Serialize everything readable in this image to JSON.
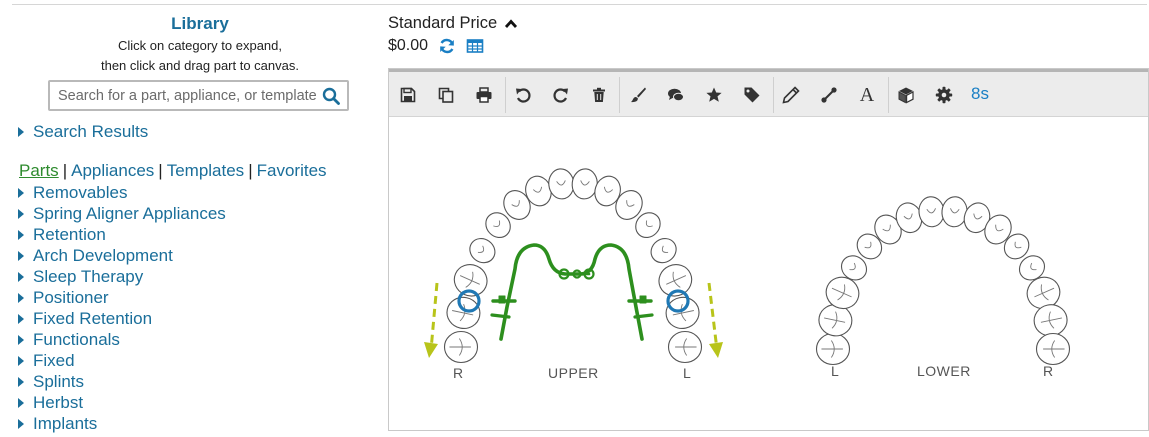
{
  "library": {
    "title": "Library",
    "help_line1": "Click on category to expand,",
    "help_line2": "then click and drag part to canvas.",
    "search_placeholder": "Search for a part, appliance, or template",
    "search_results_label": "Search Results",
    "tabs": [
      {
        "label": "Parts",
        "active": true
      },
      {
        "label": "Appliances",
        "active": false
      },
      {
        "label": "Templates",
        "active": false
      },
      {
        "label": "Favorites",
        "active": false
      }
    ],
    "tab_separator": "|",
    "categories": [
      "Removables",
      "Spring Aligner Appliances",
      "Retention",
      "Arch Development",
      "Sleep Therapy",
      "Positioner",
      "Fixed Retention",
      "Functionals",
      "Fixed",
      "Splints",
      "Herbst",
      "Implants"
    ]
  },
  "price": {
    "title": "Standard Price",
    "value": "$0.00"
  },
  "toolbar": {
    "icons": [
      "save-icon",
      "copy-icon",
      "print-icon",
      "undo-icon",
      "redo-icon",
      "trash-icon",
      "brush-icon",
      "comment-icon",
      "star-icon",
      "tag-icon",
      "pencil-icon",
      "connector-icon",
      "text-icon",
      "cube-icon",
      "gear-icon"
    ],
    "text_tool_label": "A",
    "timer_label": "8s"
  },
  "canvas": {
    "upper": {
      "label": "UPPER",
      "left": "R",
      "right": "L"
    },
    "lower": {
      "label": "LOWER",
      "left": "L",
      "right": "R"
    }
  },
  "colors": {
    "link": "#1a6e9a",
    "active_tab": "#2e8b2e",
    "appliance_wire": "#2d8f1e",
    "clasp_ring": "#1f78b4",
    "arrow": "#b8c41a"
  }
}
